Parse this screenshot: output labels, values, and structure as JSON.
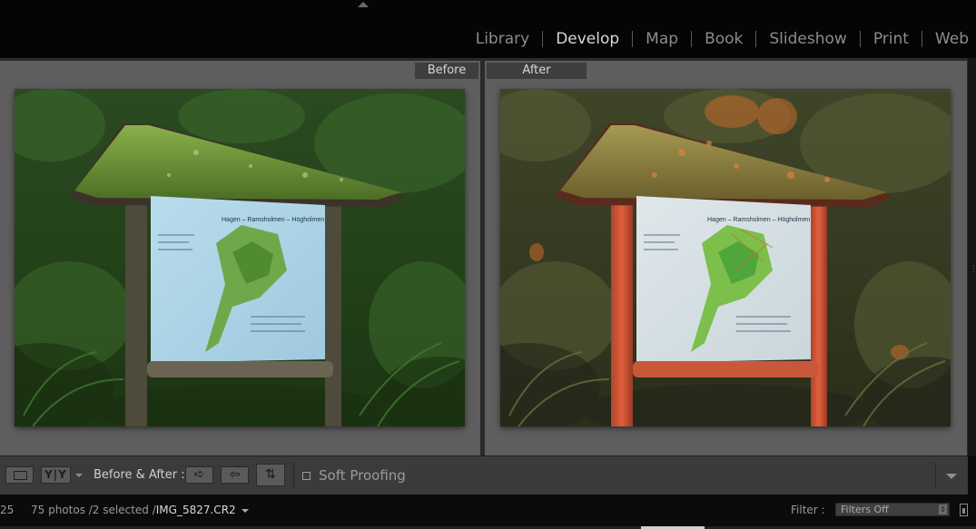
{
  "modules": [
    "Library",
    "Develop",
    "Map",
    "Book",
    "Slideshow",
    "Print",
    "Web"
  ],
  "active_module": "Develop",
  "compare": {
    "before_label": "Before",
    "after_label": "After",
    "sign_title": "Hagen – Ramsholmen – Högholmen"
  },
  "toolbar": {
    "loupe_icon": "loupe-view-icon",
    "view_mode_label": "Y|Y",
    "before_after_label": "Before & After :",
    "swap_icons": [
      "copy-before-to-after-icon",
      "copy-after-to-before-icon",
      "swap-before-after-icon"
    ],
    "soft_proofing_label": "Soft Proofing",
    "soft_proofing_checked": false
  },
  "filmstrip": {
    "page_number": "25",
    "info": "75 photos /2 selected /",
    "filename": "IMG_5827.CR2",
    "filter_label": "Filter :",
    "filter_value": "Filters Off"
  },
  "colors": {
    "active_module": "#d8d8d8",
    "inactive_module": "#8c8c8c",
    "panel_bg": "#5e5e5e",
    "toolbar_bg": "#3b3b3b"
  }
}
